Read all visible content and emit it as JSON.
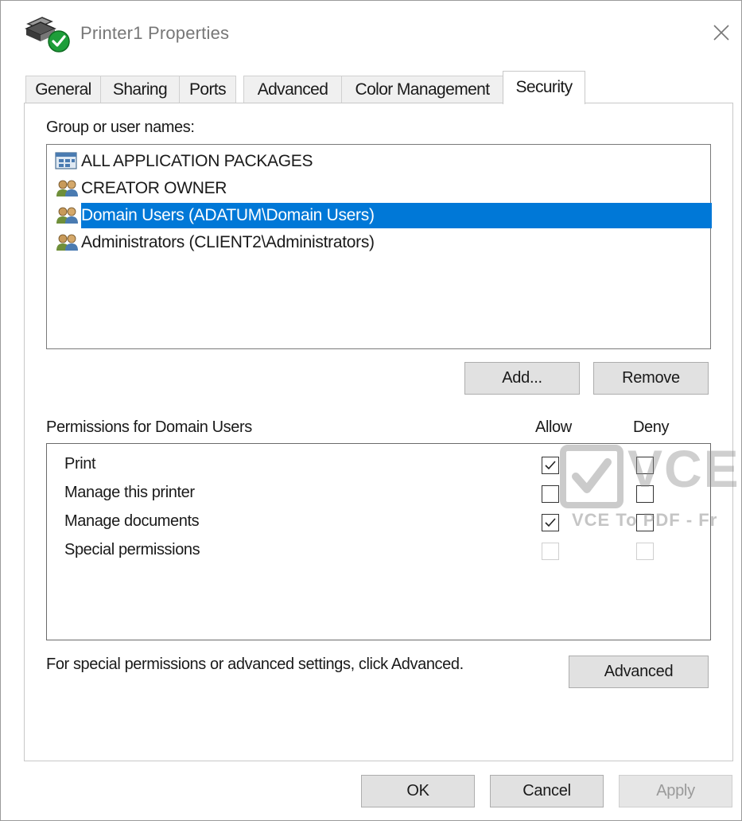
{
  "window": {
    "title": "Printer1 Properties",
    "close_icon": "close-icon"
  },
  "tabs": [
    {
      "label": "General",
      "active": false
    },
    {
      "label": "Sharing",
      "active": false
    },
    {
      "label": "Ports",
      "active": false
    },
    {
      "label": "Advanced",
      "active": false
    },
    {
      "label": "Color Management",
      "active": false
    },
    {
      "label": "Security",
      "active": true
    }
  ],
  "security": {
    "group_label": "Group or user names:",
    "users": [
      {
        "label": "ALL APPLICATION PACKAGES",
        "icon": "app-packages-icon",
        "selected": false
      },
      {
        "label": "CREATOR OWNER",
        "icon": "user-group-icon",
        "selected": false
      },
      {
        "label": "Domain Users (ADATUM\\Domain Users)",
        "icon": "user-group-icon",
        "selected": true
      },
      {
        "label": "Administrators (CLIENT2\\Administrators)",
        "icon": "user-group-icon",
        "selected": false
      }
    ],
    "add_button": "Add...",
    "remove_button": "Remove",
    "permissions_label": "Permissions for Domain Users",
    "allow_header": "Allow",
    "deny_header": "Deny",
    "permissions": [
      {
        "name": "Print",
        "allow": true,
        "deny": false,
        "enabled": true
      },
      {
        "name": "Manage this printer",
        "allow": false,
        "deny": false,
        "enabled": true
      },
      {
        "name": "Manage documents",
        "allow": true,
        "deny": false,
        "enabled": true
      },
      {
        "name": "Special permissions",
        "allow": false,
        "deny": false,
        "enabled": false
      }
    ],
    "advanced_hint": "For special permissions or advanced settings, click Advanced.",
    "advanced_button": "Advanced"
  },
  "footer": {
    "ok": "OK",
    "cancel": "Cancel",
    "apply": "Apply",
    "apply_enabled": false
  },
  "watermark": {
    "big": "VCE",
    "small": "VCE To PDF - Fr"
  },
  "colors": {
    "selection": "#0078d7",
    "button_face": "#e1e1e1",
    "tab_inactive": "#f0f0f0"
  }
}
